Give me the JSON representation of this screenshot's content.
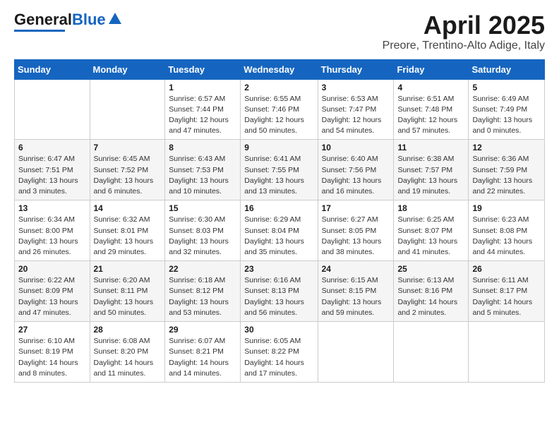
{
  "header": {
    "logo_general": "General",
    "logo_blue": "Blue",
    "title": "April 2025",
    "subtitle": "Preore, Trentino-Alto Adige, Italy"
  },
  "weekdays": [
    "Sunday",
    "Monday",
    "Tuesday",
    "Wednesday",
    "Thursday",
    "Friday",
    "Saturday"
  ],
  "weeks": [
    [
      {
        "day": "",
        "info": ""
      },
      {
        "day": "",
        "info": ""
      },
      {
        "day": "1",
        "info": "Sunrise: 6:57 AM\nSunset: 7:44 PM\nDaylight: 12 hours and 47 minutes."
      },
      {
        "day": "2",
        "info": "Sunrise: 6:55 AM\nSunset: 7:46 PM\nDaylight: 12 hours and 50 minutes."
      },
      {
        "day": "3",
        "info": "Sunrise: 6:53 AM\nSunset: 7:47 PM\nDaylight: 12 hours and 54 minutes."
      },
      {
        "day": "4",
        "info": "Sunrise: 6:51 AM\nSunset: 7:48 PM\nDaylight: 12 hours and 57 minutes."
      },
      {
        "day": "5",
        "info": "Sunrise: 6:49 AM\nSunset: 7:49 PM\nDaylight: 13 hours and 0 minutes."
      }
    ],
    [
      {
        "day": "6",
        "info": "Sunrise: 6:47 AM\nSunset: 7:51 PM\nDaylight: 13 hours and 3 minutes."
      },
      {
        "day": "7",
        "info": "Sunrise: 6:45 AM\nSunset: 7:52 PM\nDaylight: 13 hours and 6 minutes."
      },
      {
        "day": "8",
        "info": "Sunrise: 6:43 AM\nSunset: 7:53 PM\nDaylight: 13 hours and 10 minutes."
      },
      {
        "day": "9",
        "info": "Sunrise: 6:41 AM\nSunset: 7:55 PM\nDaylight: 13 hours and 13 minutes."
      },
      {
        "day": "10",
        "info": "Sunrise: 6:40 AM\nSunset: 7:56 PM\nDaylight: 13 hours and 16 minutes."
      },
      {
        "day": "11",
        "info": "Sunrise: 6:38 AM\nSunset: 7:57 PM\nDaylight: 13 hours and 19 minutes."
      },
      {
        "day": "12",
        "info": "Sunrise: 6:36 AM\nSunset: 7:59 PM\nDaylight: 13 hours and 22 minutes."
      }
    ],
    [
      {
        "day": "13",
        "info": "Sunrise: 6:34 AM\nSunset: 8:00 PM\nDaylight: 13 hours and 26 minutes."
      },
      {
        "day": "14",
        "info": "Sunrise: 6:32 AM\nSunset: 8:01 PM\nDaylight: 13 hours and 29 minutes."
      },
      {
        "day": "15",
        "info": "Sunrise: 6:30 AM\nSunset: 8:03 PM\nDaylight: 13 hours and 32 minutes."
      },
      {
        "day": "16",
        "info": "Sunrise: 6:29 AM\nSunset: 8:04 PM\nDaylight: 13 hours and 35 minutes."
      },
      {
        "day": "17",
        "info": "Sunrise: 6:27 AM\nSunset: 8:05 PM\nDaylight: 13 hours and 38 minutes."
      },
      {
        "day": "18",
        "info": "Sunrise: 6:25 AM\nSunset: 8:07 PM\nDaylight: 13 hours and 41 minutes."
      },
      {
        "day": "19",
        "info": "Sunrise: 6:23 AM\nSunset: 8:08 PM\nDaylight: 13 hours and 44 minutes."
      }
    ],
    [
      {
        "day": "20",
        "info": "Sunrise: 6:22 AM\nSunset: 8:09 PM\nDaylight: 13 hours and 47 minutes."
      },
      {
        "day": "21",
        "info": "Sunrise: 6:20 AM\nSunset: 8:11 PM\nDaylight: 13 hours and 50 minutes."
      },
      {
        "day": "22",
        "info": "Sunrise: 6:18 AM\nSunset: 8:12 PM\nDaylight: 13 hours and 53 minutes."
      },
      {
        "day": "23",
        "info": "Sunrise: 6:16 AM\nSunset: 8:13 PM\nDaylight: 13 hours and 56 minutes."
      },
      {
        "day": "24",
        "info": "Sunrise: 6:15 AM\nSunset: 8:15 PM\nDaylight: 13 hours and 59 minutes."
      },
      {
        "day": "25",
        "info": "Sunrise: 6:13 AM\nSunset: 8:16 PM\nDaylight: 14 hours and 2 minutes."
      },
      {
        "day": "26",
        "info": "Sunrise: 6:11 AM\nSunset: 8:17 PM\nDaylight: 14 hours and 5 minutes."
      }
    ],
    [
      {
        "day": "27",
        "info": "Sunrise: 6:10 AM\nSunset: 8:19 PM\nDaylight: 14 hours and 8 minutes."
      },
      {
        "day": "28",
        "info": "Sunrise: 6:08 AM\nSunset: 8:20 PM\nDaylight: 14 hours and 11 minutes."
      },
      {
        "day": "29",
        "info": "Sunrise: 6:07 AM\nSunset: 8:21 PM\nDaylight: 14 hours and 14 minutes."
      },
      {
        "day": "30",
        "info": "Sunrise: 6:05 AM\nSunset: 8:22 PM\nDaylight: 14 hours and 17 minutes."
      },
      {
        "day": "",
        "info": ""
      },
      {
        "day": "",
        "info": ""
      },
      {
        "day": "",
        "info": ""
      }
    ]
  ]
}
